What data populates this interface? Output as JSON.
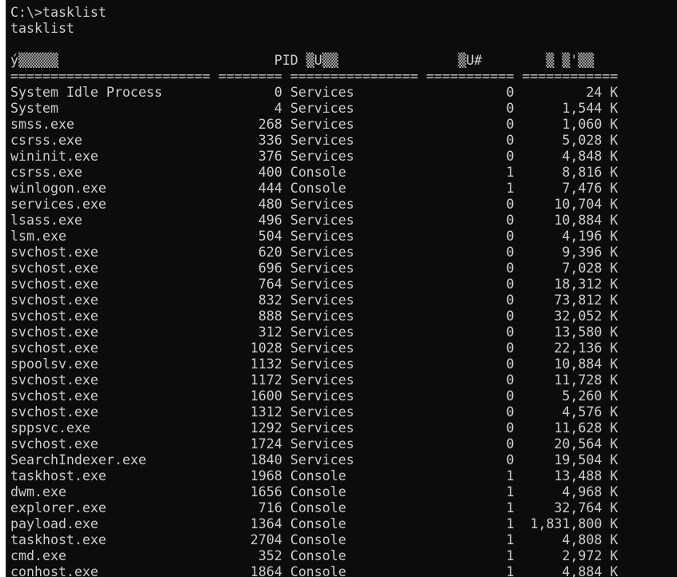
{
  "prompt_line": "C:\\>tasklist",
  "echo_line": "tasklist",
  "header_line": "ý▒▒▒▒▒                           PID ▒U▒▒               ▒U#        ▒ ▒'▒▒",
  "separator_line": "========================= ======== ================ =========== ============",
  "processes": [
    {
      "name": "System Idle Process",
      "pid": "0",
      "session_name": "Services",
      "session_num": "0",
      "mem": "24 K"
    },
    {
      "name": "System",
      "pid": "4",
      "session_name": "Services",
      "session_num": "0",
      "mem": "1,544 K"
    },
    {
      "name": "smss.exe",
      "pid": "268",
      "session_name": "Services",
      "session_num": "0",
      "mem": "1,060 K"
    },
    {
      "name": "csrss.exe",
      "pid": "336",
      "session_name": "Services",
      "session_num": "0",
      "mem": "5,028 K"
    },
    {
      "name": "wininit.exe",
      "pid": "376",
      "session_name": "Services",
      "session_num": "0",
      "mem": "4,848 K"
    },
    {
      "name": "csrss.exe",
      "pid": "400",
      "session_name": "Console",
      "session_num": "1",
      "mem": "8,816 K"
    },
    {
      "name": "winlogon.exe",
      "pid": "444",
      "session_name": "Console",
      "session_num": "1",
      "mem": "7,476 K"
    },
    {
      "name": "services.exe",
      "pid": "480",
      "session_name": "Services",
      "session_num": "0",
      "mem": "10,704 K"
    },
    {
      "name": "lsass.exe",
      "pid": "496",
      "session_name": "Services",
      "session_num": "0",
      "mem": "10,884 K"
    },
    {
      "name": "lsm.exe",
      "pid": "504",
      "session_name": "Services",
      "session_num": "0",
      "mem": "4,196 K"
    },
    {
      "name": "svchost.exe",
      "pid": "620",
      "session_name": "Services",
      "session_num": "0",
      "mem": "9,396 K"
    },
    {
      "name": "svchost.exe",
      "pid": "696",
      "session_name": "Services",
      "session_num": "0",
      "mem": "7,028 K"
    },
    {
      "name": "svchost.exe",
      "pid": "764",
      "session_name": "Services",
      "session_num": "0",
      "mem": "18,312 K"
    },
    {
      "name": "svchost.exe",
      "pid": "832",
      "session_name": "Services",
      "session_num": "0",
      "mem": "73,812 K"
    },
    {
      "name": "svchost.exe",
      "pid": "888",
      "session_name": "Services",
      "session_num": "0",
      "mem": "32,052 K"
    },
    {
      "name": "svchost.exe",
      "pid": "312",
      "session_name": "Services",
      "session_num": "0",
      "mem": "13,580 K"
    },
    {
      "name": "svchost.exe",
      "pid": "1028",
      "session_name": "Services",
      "session_num": "0",
      "mem": "22,136 K"
    },
    {
      "name": "spoolsv.exe",
      "pid": "1132",
      "session_name": "Services",
      "session_num": "0",
      "mem": "10,884 K"
    },
    {
      "name": "svchost.exe",
      "pid": "1172",
      "session_name": "Services",
      "session_num": "0",
      "mem": "11,728 K"
    },
    {
      "name": "svchost.exe",
      "pid": "1600",
      "session_name": "Services",
      "session_num": "0",
      "mem": "5,260 K"
    },
    {
      "name": "svchost.exe",
      "pid": "1312",
      "session_name": "Services",
      "session_num": "0",
      "mem": "4,576 K"
    },
    {
      "name": "sppsvc.exe",
      "pid": "1292",
      "session_name": "Services",
      "session_num": "0",
      "mem": "11,628 K"
    },
    {
      "name": "svchost.exe",
      "pid": "1724",
      "session_name": "Services",
      "session_num": "0",
      "mem": "20,564 K"
    },
    {
      "name": "SearchIndexer.exe",
      "pid": "1840",
      "session_name": "Services",
      "session_num": "0",
      "mem": "19,504 K"
    },
    {
      "name": "taskhost.exe",
      "pid": "1968",
      "session_name": "Console",
      "session_num": "1",
      "mem": "13,488 K"
    },
    {
      "name": "dwm.exe",
      "pid": "1656",
      "session_name": "Console",
      "session_num": "1",
      "mem": "4,968 K"
    },
    {
      "name": "explorer.exe",
      "pid": "716",
      "session_name": "Console",
      "session_num": "1",
      "mem": "32,764 K"
    },
    {
      "name": "payload.exe",
      "pid": "1364",
      "session_name": "Console",
      "session_num": "1",
      "mem": "1,831,800 K"
    },
    {
      "name": "taskhost.exe",
      "pid": "2704",
      "session_name": "Console",
      "session_num": "1",
      "mem": "4,808 K"
    },
    {
      "name": "cmd.exe",
      "pid": "352",
      "session_name": "Console",
      "session_num": "1",
      "mem": "2,972 K"
    },
    {
      "name": "conhost.exe",
      "pid": "1864",
      "session_name": "Console",
      "session_num": "1",
      "mem": "4,884 K"
    }
  ]
}
